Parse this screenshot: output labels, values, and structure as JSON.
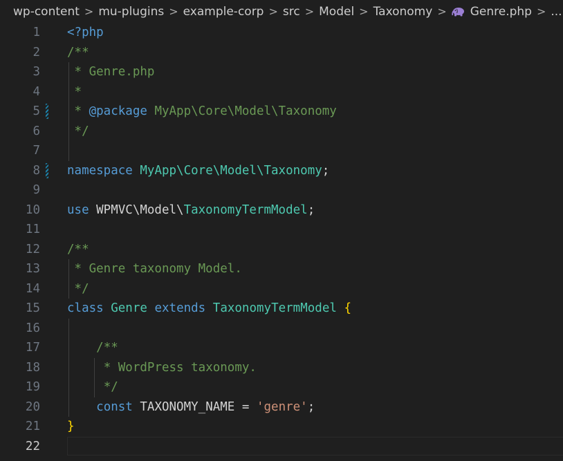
{
  "breadcrumb": {
    "items": [
      "wp-content",
      "mu-plugins",
      "example-corp",
      "src",
      "Model",
      "Taxonomy"
    ],
    "file": "Genre.php",
    "file_icon": "php-elephant-icon",
    "more": "...",
    "separator": ">"
  },
  "editor": {
    "active_line": 22,
    "modified_lines": [
      5,
      8
    ],
    "lines": [
      {
        "n": "1",
        "tokens": [
          {
            "t": "tag",
            "v": "<?php"
          }
        ]
      },
      {
        "n": "2",
        "tokens": [
          {
            "t": "cm",
            "v": "/**"
          }
        ]
      },
      {
        "n": "3",
        "tokens": [
          {
            "t": "cm",
            "v": " * Genre.php"
          }
        ]
      },
      {
        "n": "4",
        "tokens": [
          {
            "t": "cm",
            "v": " *"
          }
        ]
      },
      {
        "n": "5",
        "tokens": [
          {
            "t": "cm",
            "v": " * "
          },
          {
            "t": "cmtag",
            "v": "@package"
          },
          {
            "t": "cm",
            "v": " MyApp\\Core\\Model\\Taxonomy"
          }
        ]
      },
      {
        "n": "6",
        "tokens": [
          {
            "t": "cm",
            "v": " */"
          }
        ]
      },
      {
        "n": "7",
        "tokens": []
      },
      {
        "n": "8",
        "tokens": [
          {
            "t": "kw",
            "v": "namespace"
          },
          {
            "t": "plain",
            "v": " "
          },
          {
            "t": "ns",
            "v": "MyApp\\Core\\Model\\Taxonomy"
          },
          {
            "t": "plain",
            "v": ";"
          }
        ]
      },
      {
        "n": "9",
        "tokens": []
      },
      {
        "n": "10",
        "tokens": [
          {
            "t": "kw",
            "v": "use"
          },
          {
            "t": "plain",
            "v": " WPMVC\\Model\\"
          },
          {
            "t": "cls",
            "v": "TaxonomyTermModel"
          },
          {
            "t": "plain",
            "v": ";"
          }
        ]
      },
      {
        "n": "11",
        "tokens": []
      },
      {
        "n": "12",
        "tokens": [
          {
            "t": "cm",
            "v": "/**"
          }
        ]
      },
      {
        "n": "13",
        "tokens": [
          {
            "t": "cm",
            "v": " * Genre taxonomy Model."
          }
        ]
      },
      {
        "n": "14",
        "tokens": [
          {
            "t": "cm",
            "v": " */"
          }
        ]
      },
      {
        "n": "15",
        "tokens": [
          {
            "t": "kw",
            "v": "class"
          },
          {
            "t": "plain",
            "v": " "
          },
          {
            "t": "cls",
            "v": "Genre"
          },
          {
            "t": "plain",
            "v": " "
          },
          {
            "t": "kw",
            "v": "extends"
          },
          {
            "t": "plain",
            "v": " "
          },
          {
            "t": "cls",
            "v": "TaxonomyTermModel"
          },
          {
            "t": "plain",
            "v": " "
          },
          {
            "t": "brace",
            "v": "{"
          }
        ]
      },
      {
        "n": "16",
        "tokens": []
      },
      {
        "n": "17",
        "tokens": [
          {
            "t": "plain",
            "v": "    "
          },
          {
            "t": "cm",
            "v": "/**"
          }
        ]
      },
      {
        "n": "18",
        "tokens": [
          {
            "t": "plain",
            "v": "    "
          },
          {
            "t": "cm",
            "v": " * WordPress taxonomy."
          }
        ]
      },
      {
        "n": "19",
        "tokens": [
          {
            "t": "plain",
            "v": "    "
          },
          {
            "t": "cm",
            "v": " */"
          }
        ]
      },
      {
        "n": "20",
        "tokens": [
          {
            "t": "plain",
            "v": "    "
          },
          {
            "t": "kw",
            "v": "const"
          },
          {
            "t": "plain",
            "v": " TAXONOMY_NAME = "
          },
          {
            "t": "str",
            "v": "'genre'"
          },
          {
            "t": "plain",
            "v": ";"
          }
        ]
      },
      {
        "n": "21",
        "tokens": [
          {
            "t": "brace",
            "v": "}"
          }
        ]
      },
      {
        "n": "22",
        "tokens": []
      }
    ]
  },
  "colors": {
    "background": "#1f1f1f",
    "keyword": "#569cd6",
    "comment": "#6a9955",
    "class_name": "#4ec9b0",
    "string": "#ce9178",
    "bracket": "#ffd700",
    "line_number": "#6e7681",
    "modified_marker": "#1b81a8"
  }
}
